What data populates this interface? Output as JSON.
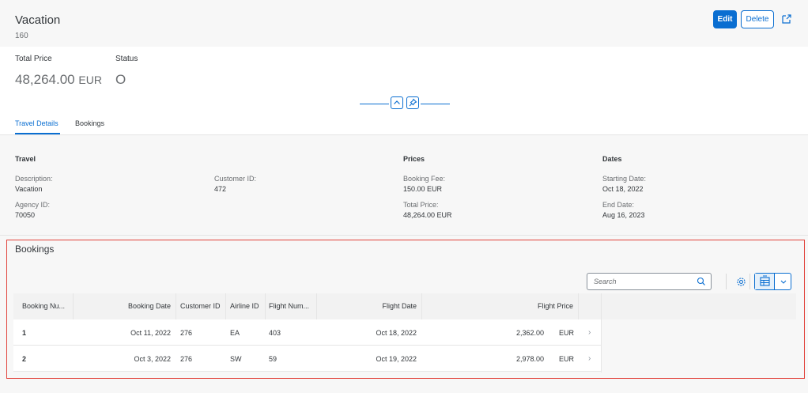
{
  "header": {
    "title": "Vacation",
    "subtitle": "160",
    "edit_label": "Edit",
    "delete_label": "Delete"
  },
  "kpis": {
    "total_price_label": "Total Price",
    "total_price_value": "48,264.00",
    "total_price_currency": "EUR",
    "status_label": "Status",
    "status_value": "O"
  },
  "tabs": [
    {
      "label": "Travel Details",
      "active": true
    },
    {
      "label": "Bookings",
      "active": false
    }
  ],
  "travel": {
    "heading": "Travel",
    "description_label": "Description:",
    "description_value": "Vacation",
    "customer_id_label": "Customer ID:",
    "customer_id_value": "472",
    "agency_id_label": "Agency ID:",
    "agency_id_value": "70050"
  },
  "prices": {
    "heading": "Prices",
    "booking_fee_label": "Booking Fee:",
    "booking_fee_value": "150.00 EUR",
    "total_price_label": "Total Price:",
    "total_price_value": "48,264.00 EUR"
  },
  "dates": {
    "heading": "Dates",
    "start_label": "Starting Date:",
    "start_value": "Oct 18, 2022",
    "end_label": "End Date:",
    "end_value": "Aug 16, 2023"
  },
  "bookings": {
    "title": "Bookings",
    "search_placeholder": "Search",
    "columns": [
      "Booking Nu...",
      "Booking Date",
      "Customer ID",
      "Airline ID",
      "Flight Num...",
      "Flight Date",
      "Flight Price"
    ],
    "rows": [
      {
        "booking_number": "1",
        "booking_date": "Oct 11, 2022",
        "customer_id": "276",
        "airline_id": "EA",
        "flight_number": "403",
        "flight_date": "Oct 18, 2022",
        "flight_price": "2,362.00",
        "currency": "EUR"
      },
      {
        "booking_number": "2",
        "booking_date": "Oct 3, 2022",
        "customer_id": "276",
        "airline_id": "SW",
        "flight_number": "59",
        "flight_date": "Oct 19, 2022",
        "flight_price": "2,978.00",
        "currency": "EUR"
      }
    ]
  },
  "colors": {
    "accent": "#0a6ed1",
    "highlight_frame": "#e1423a"
  }
}
